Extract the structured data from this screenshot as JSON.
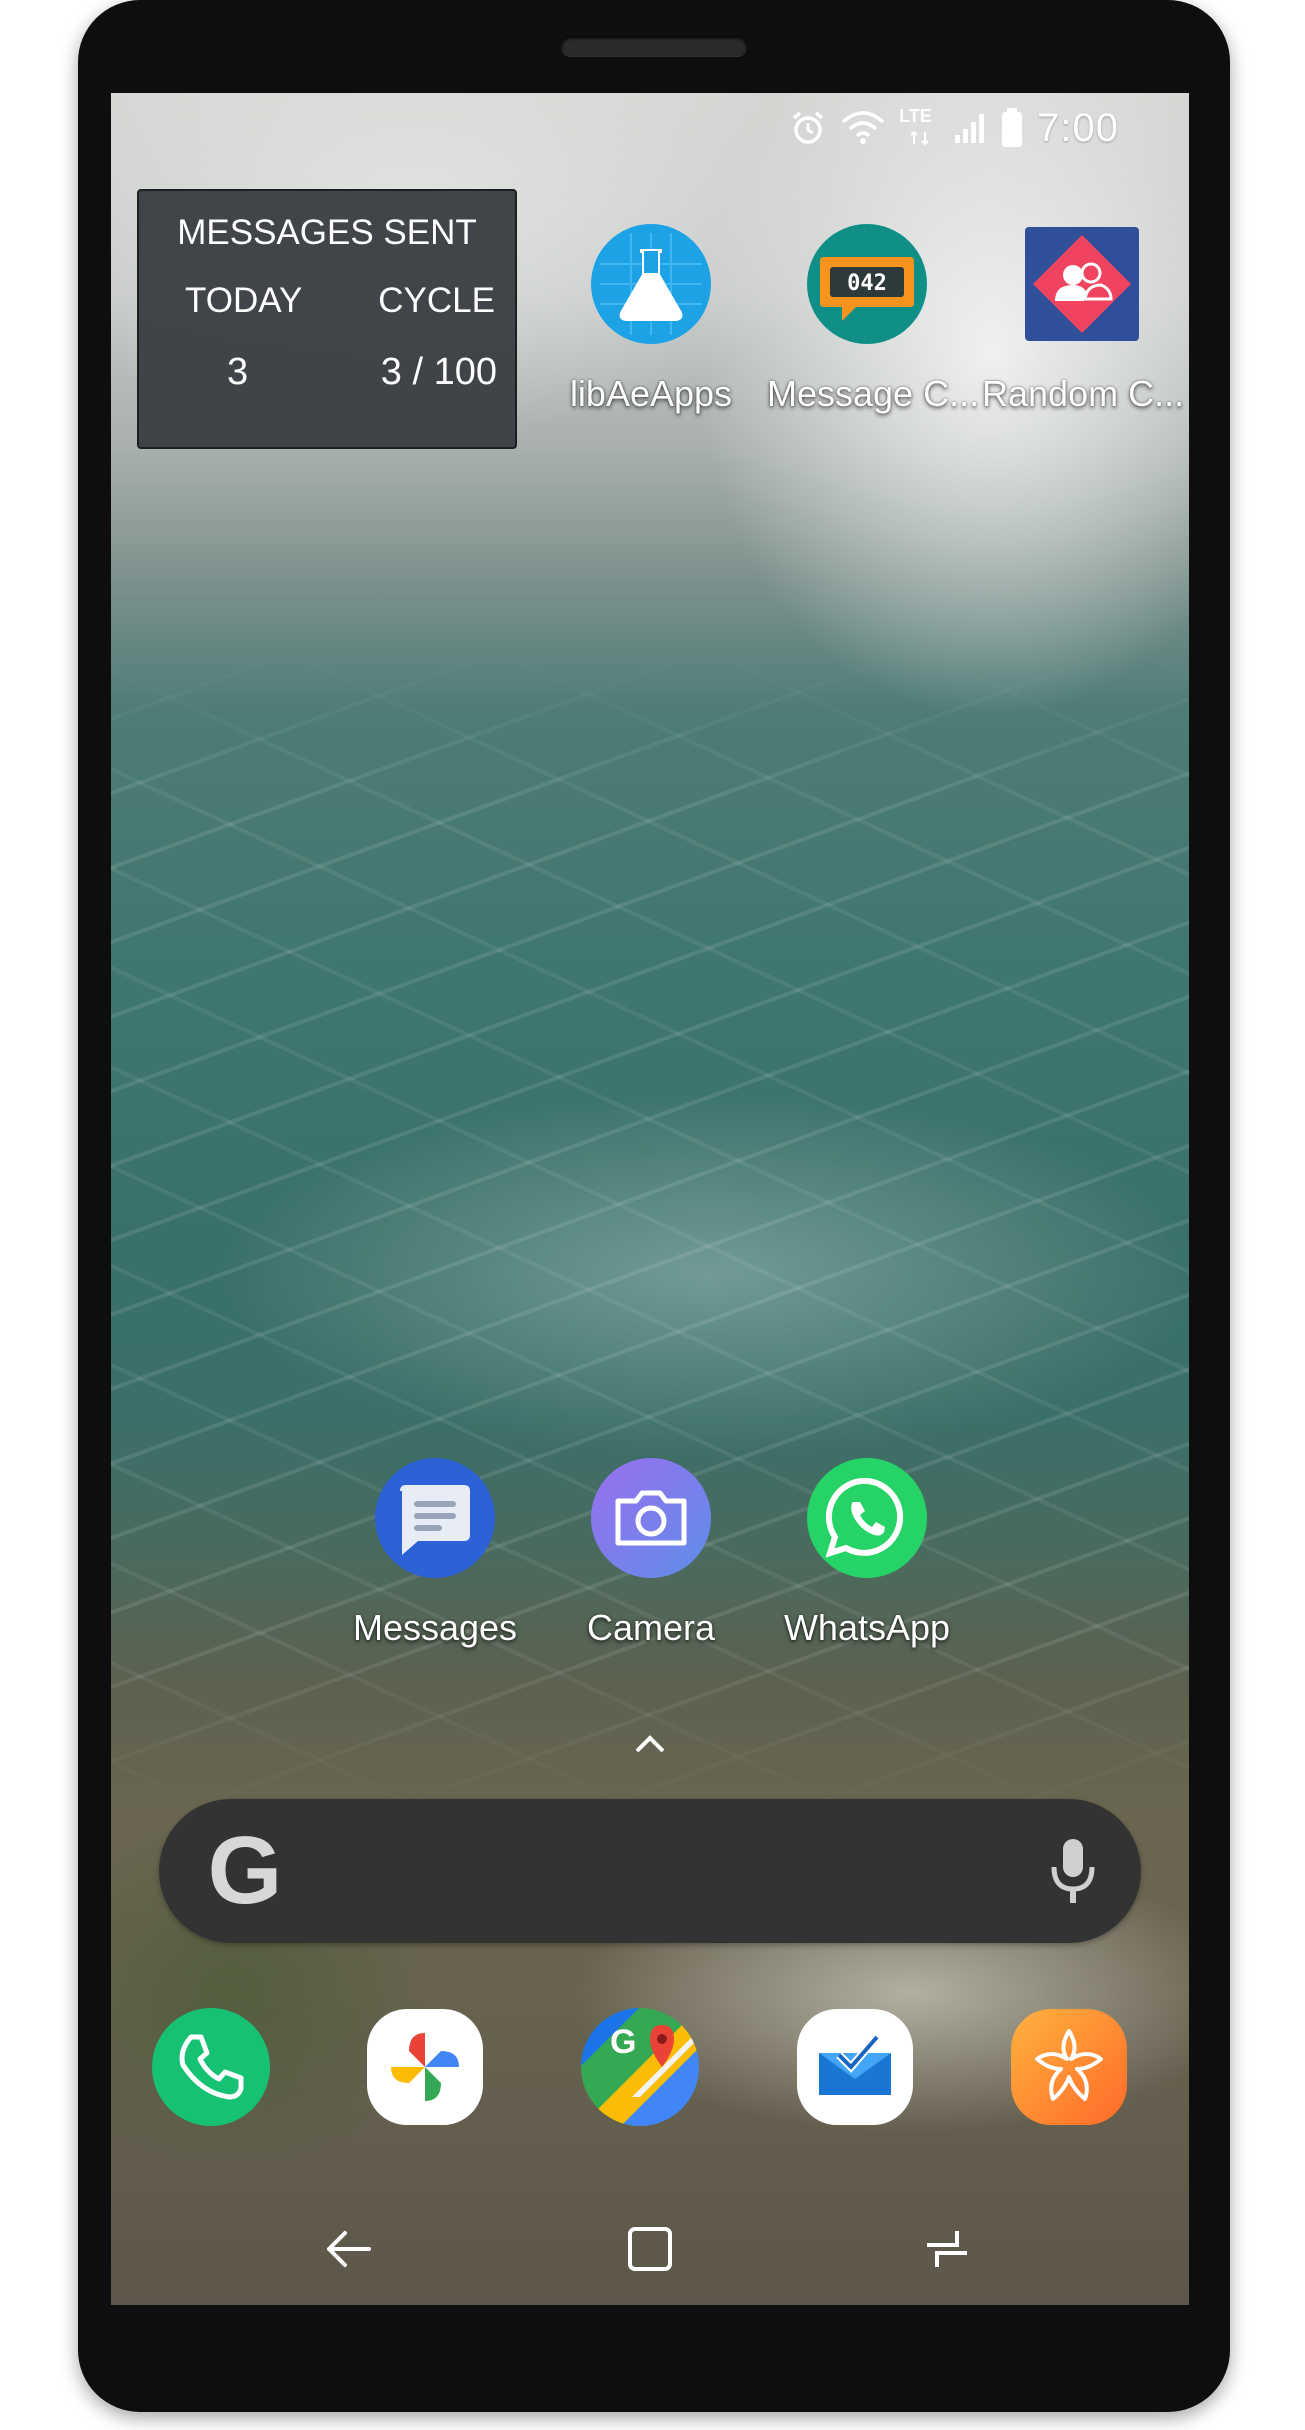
{
  "status_bar": {
    "time": "7:00",
    "network_label": "LTE",
    "icons": [
      "alarm-icon",
      "wifi-icon",
      "signal-icon",
      "battery-icon"
    ]
  },
  "widget": {
    "title": "MESSAGES SENT",
    "today_label": "TODAY",
    "cycle_label": "CYCLE",
    "today_value": "3",
    "cycle_value": "3 / 100"
  },
  "home_apps": [
    {
      "label": "libAeApps",
      "icon": "flask-icon",
      "color": "#1da1e8"
    },
    {
      "label": "Message C...",
      "icon": "counter-icon",
      "counter_text": "042",
      "color": "#0f8f86"
    },
    {
      "label": "Random C...",
      "icon": "random-contact-icon",
      "color": "#2f4f9a"
    }
  ],
  "favorites": [
    {
      "label": "Messages",
      "icon": "messages-icon",
      "color": "#2c62d6"
    },
    {
      "label": "Camera",
      "icon": "camera-icon",
      "color": "#7a6fe6"
    },
    {
      "label": "WhatsApp",
      "icon": "whatsapp-icon",
      "color": "#25d366"
    }
  ],
  "search": {
    "logo": "G",
    "icon_left": "google-icon",
    "icon_right": "mic-icon"
  },
  "dock": [
    {
      "icon": "phone-icon",
      "color": "#16c173"
    },
    {
      "icon": "photos-icon",
      "color": "#ffffff"
    },
    {
      "icon": "maps-icon",
      "color": "#34a853"
    },
    {
      "icon": "inbox-icon",
      "color": "#ffffff"
    },
    {
      "icon": "galaxy-icon",
      "color": "#ff9532"
    }
  ],
  "nav": {
    "icons": [
      "back-icon",
      "home-icon",
      "recents-icon"
    ]
  }
}
